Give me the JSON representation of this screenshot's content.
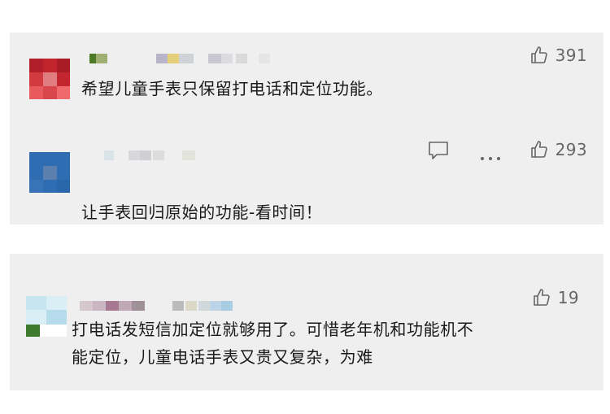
{
  "comments": [
    {
      "text": "希望儿童手表只保留打电话和定位功能。",
      "likes": "391",
      "icons": [
        "thumb-up-icon"
      ]
    },
    {
      "text": "让手表回归原始的功能-看时间！",
      "likes": "293",
      "icons": [
        "comment-icon",
        "more-icon",
        "thumb-up-icon"
      ]
    },
    {
      "text_line1": "打电话发短信加定位就够用了。可惜老年机和功能机不",
      "text_line2": "能定位，儿童电话手表又贵又复杂，为难",
      "likes": "19",
      "icons": [
        "thumb-up-icon"
      ]
    }
  ],
  "colors": {
    "card_bg": "#efefef",
    "text": "#1a1a1a",
    "meta": "#666666",
    "avatar1": "#c4262f",
    "avatar2": "#2e6db2"
  }
}
